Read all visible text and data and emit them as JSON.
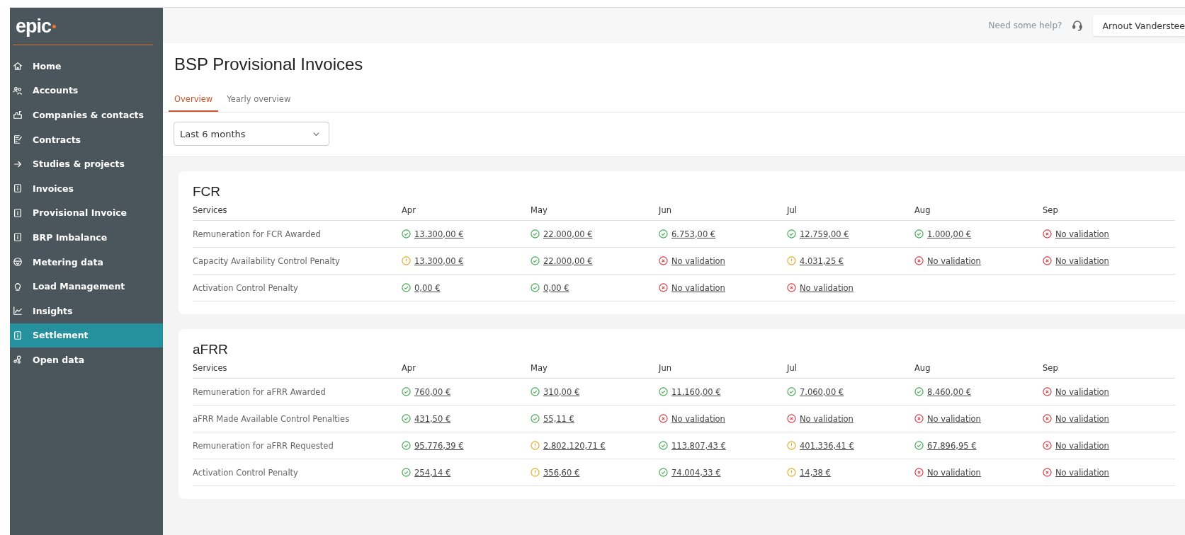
{
  "logo": "epic",
  "sidebar": {
    "items": [
      {
        "label": "Home",
        "selected": false
      },
      {
        "label": "Accounts",
        "selected": false
      },
      {
        "label": "Companies & contacts",
        "selected": false
      },
      {
        "label": "Contracts",
        "selected": false
      },
      {
        "label": "Studies & projects",
        "selected": false
      },
      {
        "label": "Invoices",
        "selected": false
      },
      {
        "label": "Provisional Invoice",
        "selected": false
      },
      {
        "label": "BRP Imbalance",
        "selected": false
      },
      {
        "label": "Metering data",
        "selected": false
      },
      {
        "label": "Load Management",
        "selected": false
      },
      {
        "label": "Insights",
        "selected": false
      },
      {
        "label": "Settlement",
        "selected": true
      },
      {
        "label": "Open data",
        "selected": false
      }
    ]
  },
  "header": {
    "help": "Need some help?",
    "user": "Arnout Vanderstee"
  },
  "title": "BSP Provisional Invoices",
  "tabs": [
    {
      "label": "Overview",
      "selected": true
    },
    {
      "label": "Yearly overview",
      "selected": false
    }
  ],
  "period": {
    "value": "Last 6 months"
  },
  "sections": [
    {
      "title": "FCR",
      "columns": [
        "Services",
        "Apr",
        "May",
        "Jun",
        "Jul",
        "Aug",
        "Sep"
      ],
      "rows": [
        {
          "service": "Remuneration for FCR Awarded",
          "cells": [
            {
              "kind": "ok",
              "text": "13.300,00 €"
            },
            {
              "kind": "ok",
              "text": "22.000,00 €"
            },
            {
              "kind": "ok",
              "text": "6.753,00 €"
            },
            {
              "kind": "ok",
              "text": "12.759,00 €"
            },
            {
              "kind": "ok",
              "text": "1.000,00 €"
            },
            {
              "kind": "error",
              "text": "No validation"
            }
          ]
        },
        {
          "service": "Capacity Availability Control Penalty",
          "cells": [
            {
              "kind": "warning",
              "text": "13.300,00 €"
            },
            {
              "kind": "ok",
              "text": "22.000,00 €"
            },
            {
              "kind": "error",
              "text": "No validation"
            },
            {
              "kind": "warning",
              "text": "4.031,25 €"
            },
            {
              "kind": "error",
              "text": "No validation"
            },
            {
              "kind": "error",
              "text": "No validation"
            }
          ]
        },
        {
          "service": "Activation Control Penalty",
          "cells": [
            {
              "kind": "ok",
              "text": "0,00 €"
            },
            {
              "kind": "ok",
              "text": "0,00 €"
            },
            {
              "kind": "error",
              "text": "No validation"
            },
            {
              "kind": "error",
              "text": "No validation"
            }
          ]
        }
      ]
    },
    {
      "title": "aFRR",
      "columns": [
        "Services",
        "Apr",
        "May",
        "Jun",
        "Jul",
        "Aug",
        "Sep"
      ],
      "rows": [
        {
          "service": "Remuneration for aFRR Awarded",
          "cells": [
            {
              "kind": "ok",
              "text": "760,00 €"
            },
            {
              "kind": "ok",
              "text": "310,00 €"
            },
            {
              "kind": "ok",
              "text": "11.160,00 €"
            },
            {
              "kind": "ok",
              "text": "7.060,00 €"
            },
            {
              "kind": "ok",
              "text": "8.460,00 €"
            },
            {
              "kind": "error",
              "text": "No validation"
            }
          ]
        },
        {
          "service": "aFRR Made Available Control Penalties",
          "cells": [
            {
              "kind": "ok",
              "text": "431,50 €"
            },
            {
              "kind": "ok",
              "text": "55,11 €"
            },
            {
              "kind": "error",
              "text": "No validation"
            },
            {
              "kind": "error",
              "text": "No validation"
            },
            {
              "kind": "error",
              "text": "No validation"
            },
            {
              "kind": "error",
              "text": "No validation"
            }
          ]
        },
        {
          "service": "Remuneration for aFRR Requested",
          "cells": [
            {
              "kind": "ok",
              "text": "95.776,39 €"
            },
            {
              "kind": "warning",
              "text": "2.802.120,71 €"
            },
            {
              "kind": "ok",
              "text": "113.807,43 €"
            },
            {
              "kind": "warning",
              "text": "401.336,41 €"
            },
            {
              "kind": "ok",
              "text": "67.896,95 €"
            },
            {
              "kind": "error",
              "text": "No validation"
            }
          ]
        },
        {
          "service": "Activation Control Penalty",
          "cells": [
            {
              "kind": "ok",
              "text": "254,14 €"
            },
            {
              "kind": "warning",
              "text": "356,60 €"
            },
            {
              "kind": "ok",
              "text": "74.004,33 €"
            },
            {
              "kind": "warning",
              "text": "14,38 €"
            },
            {
              "kind": "error",
              "text": "No validation"
            },
            {
              "kind": "error",
              "text": "No validation"
            }
          ]
        }
      ]
    }
  ]
}
